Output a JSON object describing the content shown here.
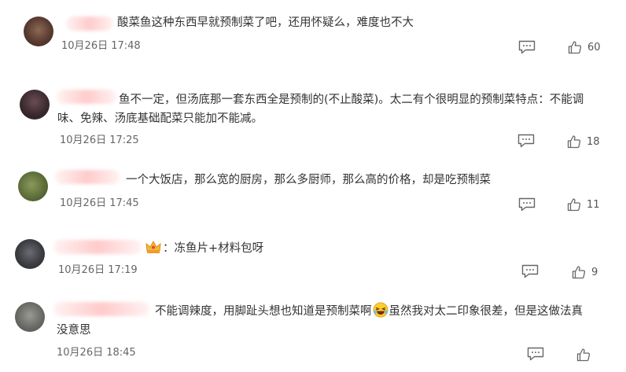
{
  "comments": [
    {
      "text": "酸菜鱼这种东西早就预制菜了吧，还用怀疑么，难度也不大",
      "time": "10月26日 17:48",
      "likes": "60",
      "avatar_color": "#5a3b30"
    },
    {
      "text_line1": "鱼不一定，但汤底那一套东西全是预制的(不止酸菜)。太二有个很明显的预制菜特点：不能调",
      "text_line2": "味、免辣、汤底基础配菜只能加不能减。",
      "time": "10月26日 17:25",
      "likes": "18",
      "avatar_color": "#3b2a2e"
    },
    {
      "text": "一个大饭店，那么宽的厨房，那么多厨师，那么高的价格，却是吃预制菜",
      "time": "10月26日 17:45",
      "likes": "11",
      "avatar_color": "#5e6e3a"
    },
    {
      "badge_icon": "crown-icon",
      "text": "：冻鱼片+材料包呀",
      "time": "10月26日 17:19",
      "likes": "9",
      "avatar_color": "#3c3d42"
    },
    {
      "text_part1": "不能调辣度，用脚趾头想也知道是预制菜啊",
      "emoji_icon": "laughing-emoji-icon",
      "text_part2": "虽然我对太二印象很差，但是这做法真",
      "text_line2": "没意思",
      "time": "10月26日 18:45",
      "likes": "",
      "avatar_color": "#6a6a66"
    }
  ]
}
